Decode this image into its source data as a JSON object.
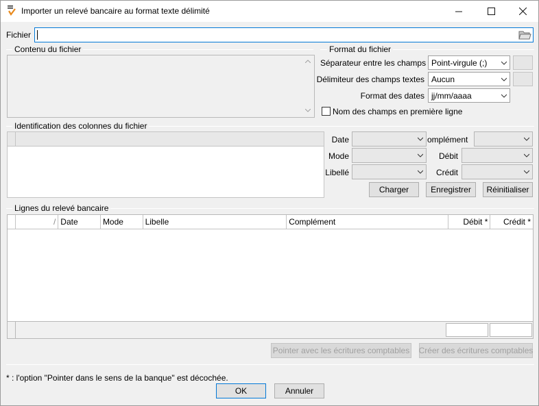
{
  "window": {
    "title": "Importer un relevé bancaire au format texte délimité",
    "minimize": "—",
    "maximize": "☐",
    "close": "✕"
  },
  "file": {
    "label": "Fichier",
    "value": ""
  },
  "content_group": {
    "title": "Contenu du fichier"
  },
  "format_group": {
    "title": "Format du fichier",
    "separator_label": "Séparateur entre les champs",
    "separator_value": "Point-virgule (;)",
    "delimiter_label": "Délimiteur des champs textes",
    "delimiter_value": "Aucun",
    "date_format_label": "Format des dates",
    "date_format_value": "jj/mm/aaaa",
    "header_checkbox_label": "Nom des champs en première ligne"
  },
  "columns_group": {
    "title": "Identification des colonnes du fichier",
    "date_label": "Date",
    "mode_label": "Mode",
    "libelle_label": "Libellé",
    "complement_label": "omplément",
    "debit_label": "Débit",
    "credit_label": "Crédit",
    "load_button": "Charger",
    "save_button": "Enregistrer",
    "reset_button": "Réinitialiser"
  },
  "lines_group": {
    "title": "Lignes du relevé bancaire",
    "columns": [
      "",
      "/",
      "Date",
      "Mode",
      "Libelle",
      "Complément",
      "Débit *",
      "Crédit *"
    ],
    "match_button": "Pointer avec les écritures comptables",
    "create_button": "Créer des écritures comptables"
  },
  "footer": {
    "note": "* : l'option \"Pointer dans le sens de la banque\" est décochée.",
    "ok_button": "OK",
    "cancel_button": "Annuler"
  },
  "colors": {
    "accent": "#0078d7",
    "icon_orange": "#e8891c"
  }
}
